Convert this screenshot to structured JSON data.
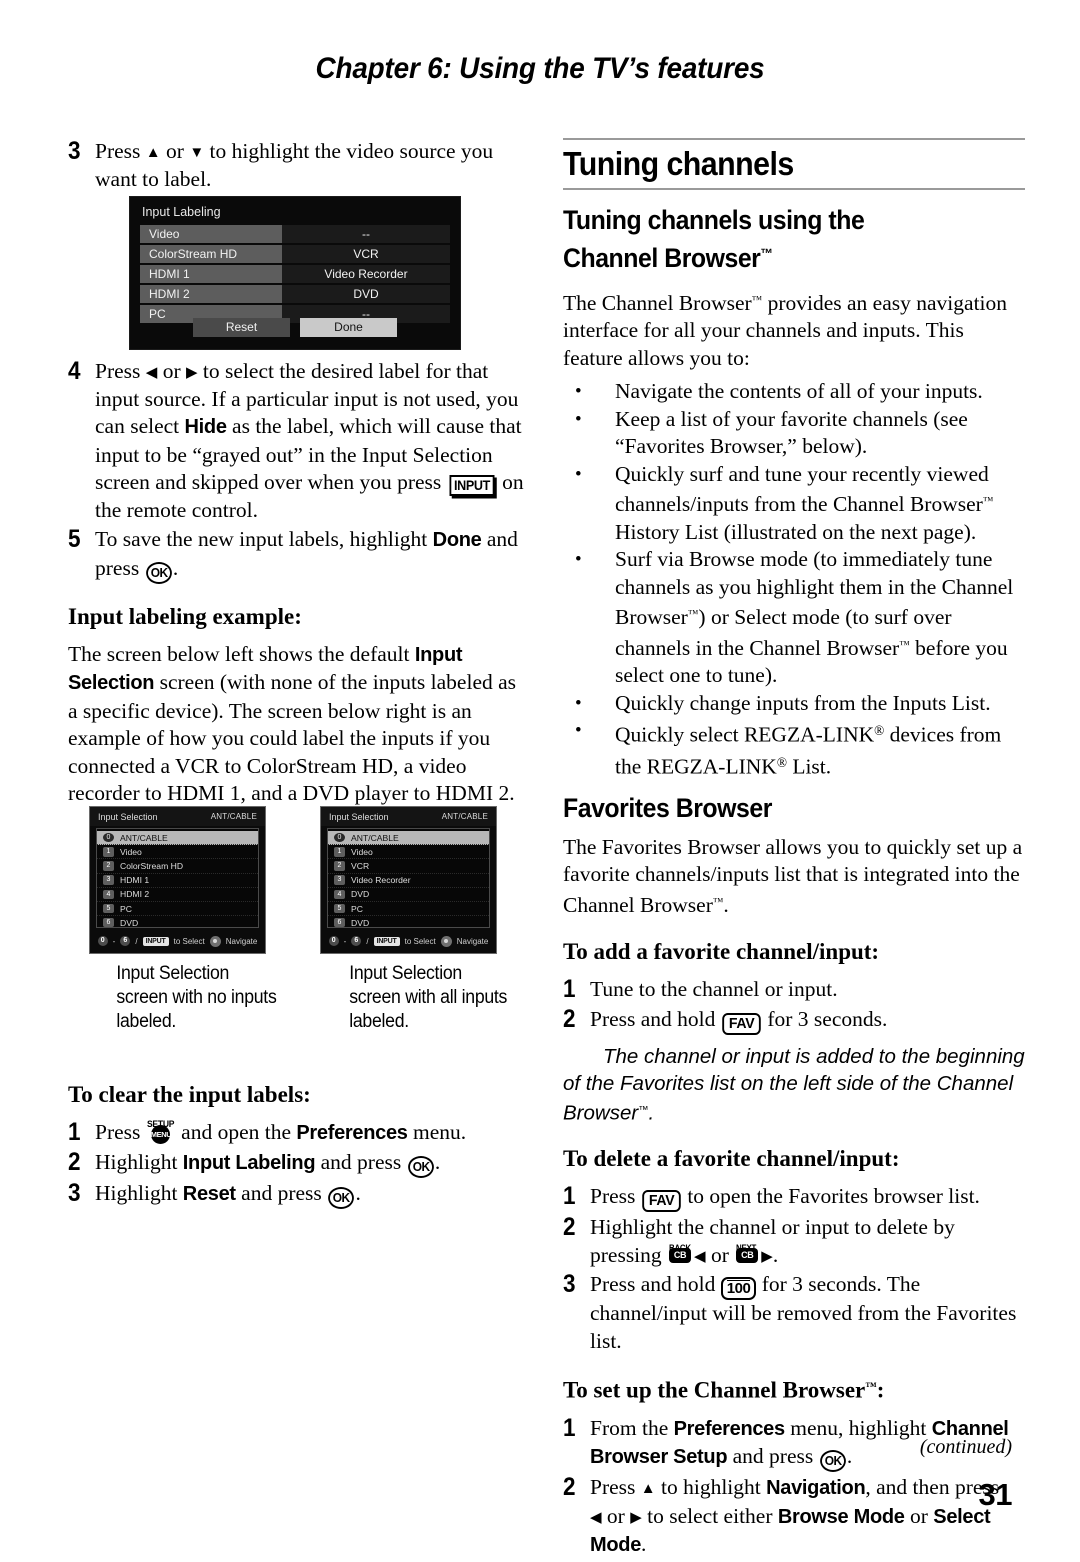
{
  "header": {
    "chapter": "Chapter 6: Using the TV’s features"
  },
  "footer": {
    "continued": "(continued)",
    "page_number": "31"
  },
  "left_column": {
    "step3": {
      "num": "3",
      "t1": "Press ",
      "t2": " or ",
      "t3": " to highlight the video source you want to label."
    },
    "input_labeling_screen": {
      "title": "Input Labeling",
      "rows": [
        {
          "label": "Video",
          "value": "--"
        },
        {
          "label": "ColorStream HD",
          "value": "VCR"
        },
        {
          "label": "HDMI 1",
          "value": "Video Recorder"
        },
        {
          "label": "HDMI 2",
          "value": "DVD"
        },
        {
          "label": "PC",
          "value": "--"
        }
      ],
      "reset_label": "Reset",
      "done_label": "Done"
    },
    "step4": {
      "num": "4",
      "t1": "Press ",
      "t2": " or ",
      "t3": " to select the desired label for that input source. If a particular input is not used, you can select ",
      "hide": "Hide",
      "t4": " as the label, which will cause that input to be “grayed out” in the Input Selection screen and skipped over when you press ",
      "input_key": "INPUT",
      "t5": " on the remote control."
    },
    "step5": {
      "num": "5",
      "t1": "To save the new input labels, highlight ",
      "done": "Done",
      "t2": " and press ",
      "ok_key": "OK",
      "t3": "."
    },
    "example_heading": "Input labeling example:",
    "example_para": {
      "t1": "The screen below left shows the default ",
      "b1": "Input Selection",
      "t2": " screen (with none of the inputs labeled as a specific device). The screen below right is an example of how you could label the inputs if you connected a VCR to ColorStream HD, a video recorder to HDMI 1, and a DVD player to HDMI 2."
    },
    "input_selection_left": {
      "title": "Input Selection",
      "current": "ANT/CABLE",
      "items": [
        {
          "num": "0",
          "label": "ANT/CABLE",
          "selected": true
        },
        {
          "num": "1",
          "label": "Video",
          "selected": false
        },
        {
          "num": "2",
          "label": "ColorStream HD",
          "selected": false
        },
        {
          "num": "3",
          "label": "HDMI 1",
          "selected": false
        },
        {
          "num": "4",
          "label": "HDMI 2",
          "selected": false
        },
        {
          "num": "5",
          "label": "PC",
          "selected": false
        },
        {
          "num": "6",
          "label": "DVD",
          "selected": false
        }
      ],
      "footer": {
        "from": "0",
        "dash": "-",
        "to": "6",
        "slash": "/",
        "input_key": "INPUT",
        "to_select": "to Select",
        "navigate": "Navigate"
      }
    },
    "input_selection_right": {
      "title": "Input Selection",
      "current": "ANT/CABLE",
      "items": [
        {
          "num": "0",
          "label": "ANT/CABLE",
          "selected": true
        },
        {
          "num": "1",
          "label": "Video",
          "selected": false
        },
        {
          "num": "2",
          "label": "VCR",
          "selected": false
        },
        {
          "num": "3",
          "label": "Video Recorder",
          "selected": false
        },
        {
          "num": "4",
          "label": "DVD",
          "selected": false
        },
        {
          "num": "5",
          "label": "PC",
          "selected": false
        },
        {
          "num": "6",
          "label": "DVD",
          "selected": false
        }
      ],
      "footer": {
        "from": "0",
        "dash": "-",
        "to": "6",
        "slash": "/",
        "input_key": "INPUT",
        "to_select": "to Select",
        "navigate": "Navigate"
      }
    },
    "caption_left": "Input Selection screen with no inputs labeled.",
    "caption_right": "Input Selection screen with all inputs labeled.",
    "clear_heading": "To clear the input labels:",
    "clear_step1": {
      "num": "1",
      "t1": "Press ",
      "setup_cap": "SETUP",
      "setup_key": "MENU",
      "t2": " and open the ",
      "b1": "Preferences",
      "t3": " menu."
    },
    "clear_step2": {
      "num": "2",
      "t1": "Highlight ",
      "b1": "Input Labeling",
      "t2": " and press ",
      "ok_key": "OK",
      "t3": "."
    },
    "clear_step3": {
      "num": "3",
      "t1": "Highlight ",
      "b1": "Reset",
      "t2": " and press ",
      "ok_key": "OK",
      "t3": "."
    }
  },
  "right_column": {
    "h_major": "Tuning channels",
    "h_minor_1": "Tuning channels using the",
    "h_minor_2": "Channel Browser",
    "intro": {
      "t1": "The Channel Browser",
      "t2": " provides an easy navigation interface for all your channels and inputs. This feature allows you to:"
    },
    "bullets": [
      {
        "t1": "Navigate the contents of all of your inputs.",
        "tm_after": ""
      },
      {
        "t1": "Keep a list of your favorite channels (see “Favorites Browser,” below).",
        "tm_after": ""
      },
      {
        "t1": "Quickly surf and tune your recently viewed channels/inputs from the Channel Browser",
        "t2": " History List (illustrated on the next page).",
        "tm_after": "yes"
      },
      {
        "t1": "Surf via Browse mode (to immediately tune channels as you highlight them in the Channel Browser",
        "t2": ") or Select mode (to surf over channels in the Channel Browser",
        "t3": " before you select one to tune).",
        "tm_after": "double"
      },
      {
        "t1": "Quickly change inputs from the Inputs List.",
        "tm_after": ""
      },
      {
        "t1": "Quickly select REGZA-LINK",
        "t2": " devices from the REGZA-LINK",
        "t3": " List.",
        "tm_after": "reg"
      }
    ],
    "h_fav": "Favorites Browser",
    "fav_para": {
      "t1": "The Favorites Browser allows you to quickly set up a favorite channels/inputs list that is integrated into the Channel Browser",
      "t2": "."
    },
    "add_heading": "To add a favorite channel/input:",
    "add_step1": {
      "num": "1",
      "t1": "Tune to the channel or input."
    },
    "add_step2": {
      "num": "2",
      "t1": "Press and hold ",
      "fav_key": "FAV",
      "t2": " for 3 seconds."
    },
    "note": {
      "t1": "The channel or input is added to the beginning of the Favorites list on the left side of the Channel Browser",
      "t2": "."
    },
    "delete_heading": "To delete a favorite channel/input:",
    "del_step1": {
      "num": "1",
      "t1": "Press ",
      "fav_key": "FAV",
      "t2": " to open the Favorites browser list."
    },
    "del_step2": {
      "num": "2",
      "t1": "Highlight the channel or input to delete by pressing ",
      "back_cap": "BACK",
      "cb_key": "CB",
      "t2": " or ",
      "next_cap": "NEXT",
      "cb_key2": "CB",
      "t3": "."
    },
    "del_step3": {
      "num": "3",
      "t1": "Press and hold ",
      "hundred_key": "100",
      "t2": " for 3 seconds. The channel/input will be removed from the Favorites list."
    },
    "setup_heading_1": "To set up the Channel Browser",
    "setup_heading_2": ":",
    "setup_step1": {
      "num": "1",
      "t1": "From the ",
      "b1": "Preferences",
      "t2": " menu, highlight ",
      "b2": "Channel Browser Setup",
      "t3": " and press ",
      "ok_key": "OK",
      "t4": "."
    },
    "setup_step2": {
      "num": "2",
      "t1": "Press ",
      "t2": " to highlight ",
      "b1": "Navigation",
      "t3": ", and then press ",
      "t4": " or ",
      "t5": " to select either ",
      "b2": "Browse Mode",
      "t6": " or ",
      "b3": "Select Mode",
      "t7": "."
    }
  }
}
